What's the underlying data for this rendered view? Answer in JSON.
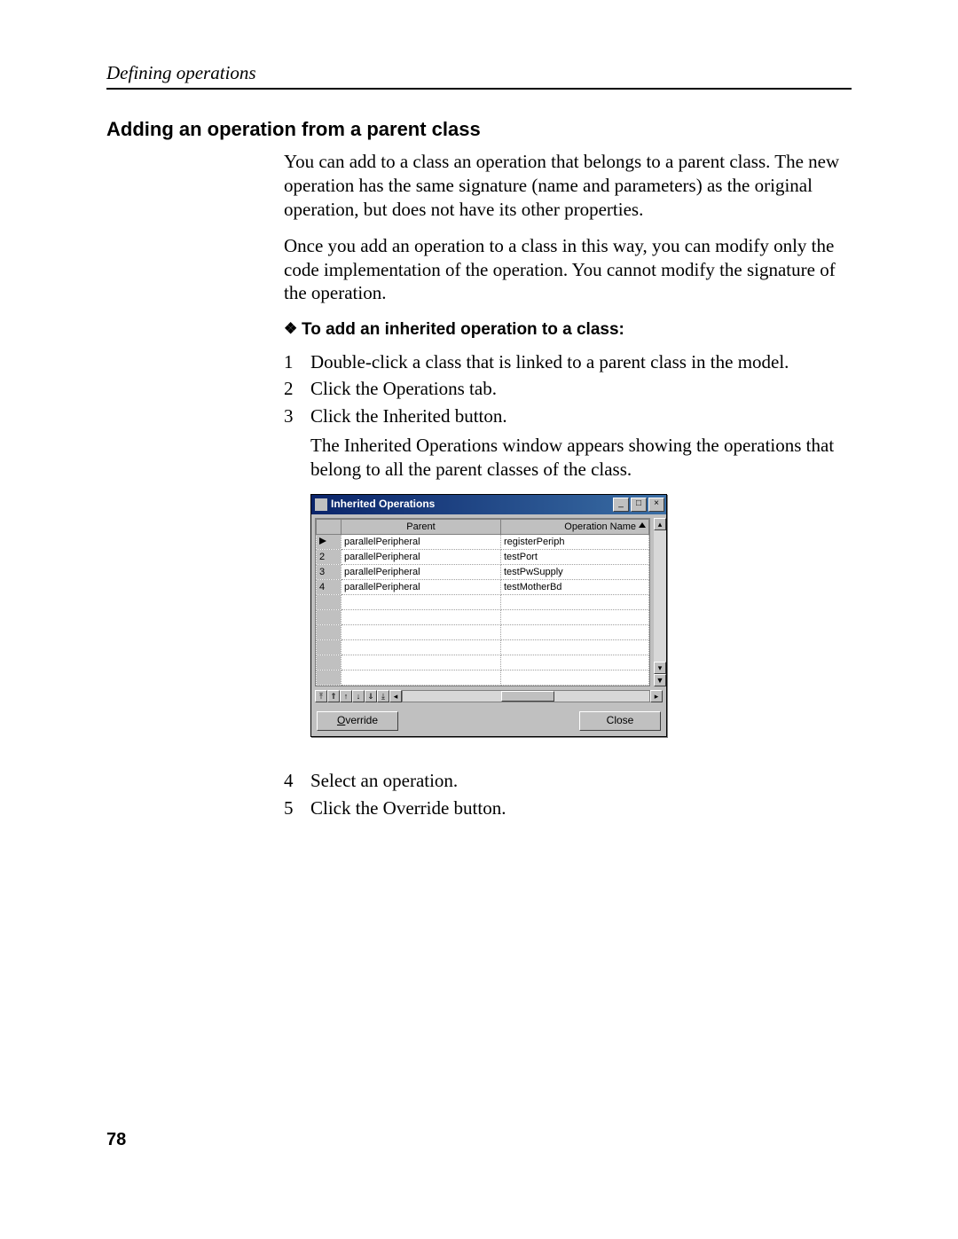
{
  "running_head": "Defining operations",
  "section_title": "Adding an operation from a parent class",
  "para1": "You can add to a class an operation that belongs to a parent class. The new operation has the same signature (name and parameters) as the original operation, but does not have its other properties.",
  "para2": "Once you add an operation to a class in this way, you can modify only the code implementation of the operation. You cannot modify the signature of the operation.",
  "subhead": "To add an inherited operation to a class:",
  "steps_a": {
    "s1": {
      "n": "1",
      "t": "Double-click a class that is linked to a parent class in the model."
    },
    "s2": {
      "n": "2",
      "t": "Click the Operations tab."
    },
    "s3": {
      "n": "3",
      "t": "Click the Inherited button."
    },
    "s3_after": "The Inherited Operations window appears showing the operations that belong to all the parent classes of the class."
  },
  "steps_b": {
    "s4": {
      "n": "4",
      "t": "Select an operation."
    },
    "s5": {
      "n": "5",
      "t": "Click the Override button."
    }
  },
  "dialog": {
    "title": "Inherited Operations",
    "headers": {
      "parent": "Parent",
      "op": "Operation Name"
    },
    "rows": [
      {
        "idx": "",
        "parent": "parallelPeripheral",
        "op": "registerPeriph",
        "selected": true
      },
      {
        "idx": "2",
        "parent": "parallelPeripheral",
        "op": "testPort"
      },
      {
        "idx": "3",
        "parent": "parallelPeripheral",
        "op": "testPwSupply"
      },
      {
        "idx": "4",
        "parent": "parallelPeripheral",
        "op": "testMotherBd"
      }
    ],
    "buttons": {
      "override_u": "O",
      "override_rest": "verride",
      "close": "Close"
    }
  },
  "page_number": "78"
}
